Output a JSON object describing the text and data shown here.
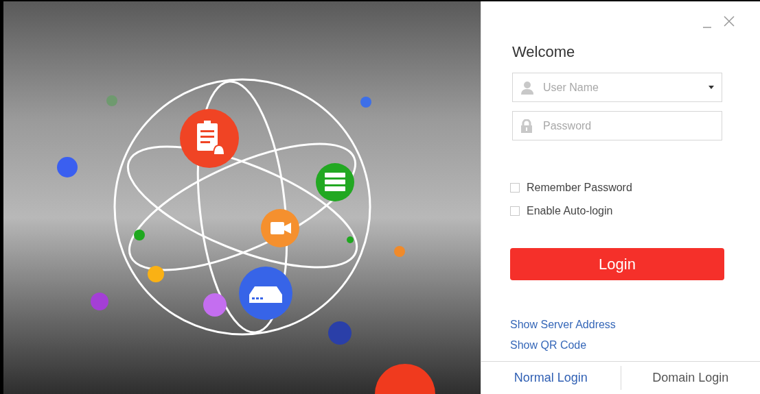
{
  "login_panel": {
    "title": "Welcome",
    "fields": [
      {
        "kind": "user",
        "placeholder": "User Name",
        "dropdown": true
      },
      {
        "kind": "password",
        "placeholder": "Password",
        "dropdown": false
      }
    ],
    "options": [
      {
        "label": "Remember Password",
        "checked": false
      },
      {
        "label": "Enable Auto-login",
        "checked": false
      }
    ],
    "login_button": "Login",
    "links": [
      "Show Server Address",
      "Show QR Code"
    ],
    "tabs": [
      {
        "label": "Normal Login",
        "selected": true
      },
      {
        "label": "Domain Login",
        "selected": false
      }
    ]
  }
}
